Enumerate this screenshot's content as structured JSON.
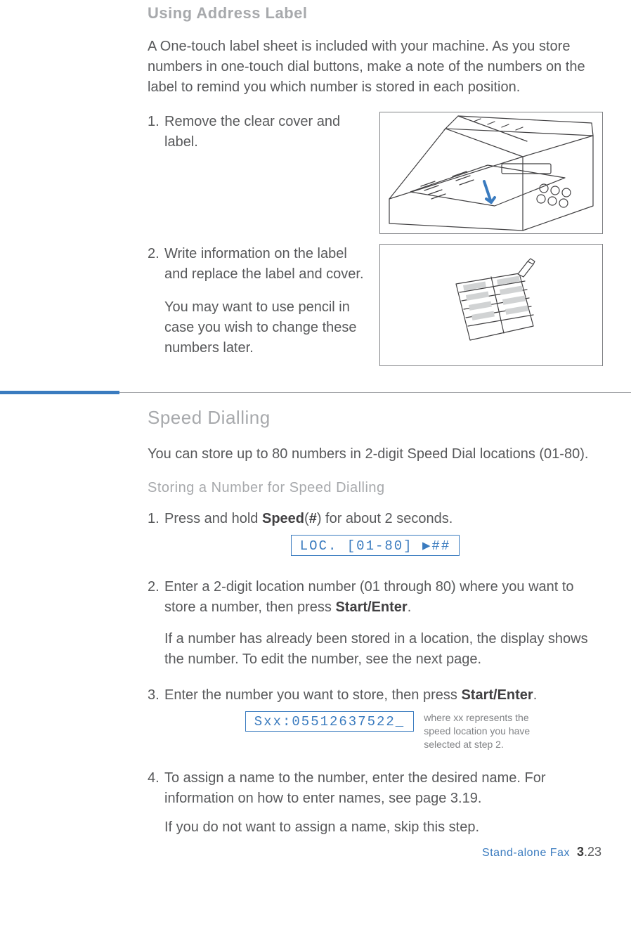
{
  "section1": {
    "title": "Using Address Label",
    "intro": "A One-touch label sheet is included with your machine. As you store numbers in one-touch dial buttons, make a note of the numbers on the label to remind you which number is stored in each position.",
    "step1_num": "1.",
    "step1_text": "Remove the clear cover and label.",
    "step2_num": "2.",
    "step2_text": "Write information on the label and replace the label and cover.",
    "step2_extra": "You may want to use pencil in case you wish to change these numbers later."
  },
  "section2": {
    "title": "Speed Dialling",
    "intro": "You can store up to 80 numbers in 2-digit Speed Dial locations (01-80).",
    "subhead": "Storing a Number for Speed Dialling",
    "step1_num": "1.",
    "step1_pre": "Press and hold ",
    "step1_b1": "Speed",
    "step1_mid": "(",
    "step1_b2": "#",
    "step1_post": ") for about 2 seconds.",
    "lcd1": "LOC. [01-80] ▶##",
    "step2_num": "2.",
    "step2_pre": "Enter a 2-digit location number (01 through 80) where you want to store a number, then press ",
    "step2_b": "Start/Enter",
    "step2_post": ".",
    "step2_extra": "If a number has already been stored in a location, the display shows the number. To edit the number, see the next page.",
    "step3_num": "3.",
    "step3_pre": "Enter the number you want to store, then press ",
    "step3_b": "Start/Enter",
    "step3_post": ".",
    "lcd2": "Sxx:05512637522_",
    "lcd2_note": "where xx represents the speed location you have selected at step 2.",
    "step4_num": "4.",
    "step4_text": "To assign a name to the number, enter the desired name. For information on how to enter names, see page 3.19.",
    "step4_extra": "If you do not want to assign a name, skip this step."
  },
  "footer": {
    "label": "Stand-alone Fax",
    "chapter": "3",
    "page": ".23"
  }
}
